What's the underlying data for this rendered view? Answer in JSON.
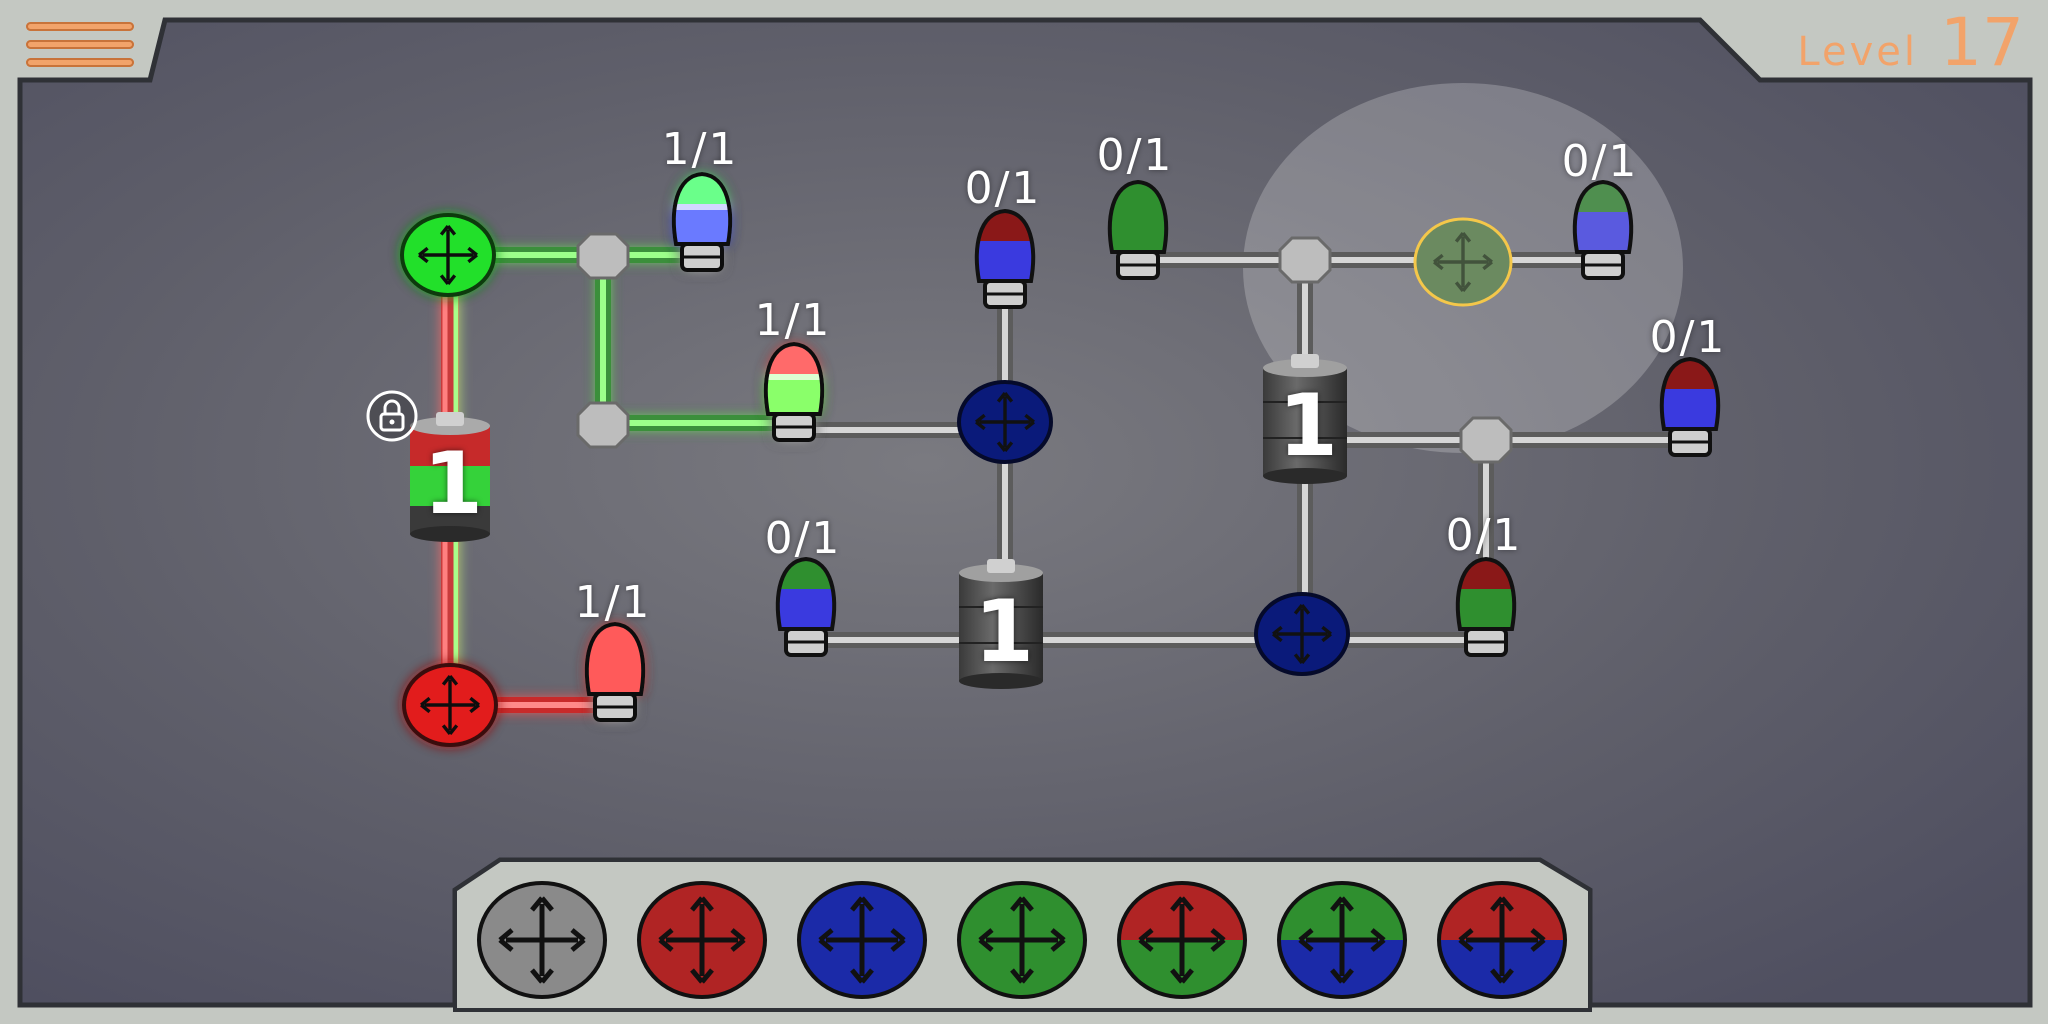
{
  "level": {
    "label": "Level",
    "number": "17"
  },
  "menu": {
    "icon": "hamburger-menu-icon"
  },
  "colors": {
    "accent": "#f2a36a",
    "red": "#b02424",
    "green": "#2f8f2f",
    "blue": "#1b2aa8",
    "gray": "#8a8a8a",
    "lit_red": "#ff4a4a",
    "lit_green": "#7cff6a"
  },
  "bulbs": [
    {
      "id": "bulb-green-blue-lit",
      "count": "1/1",
      "lit": true,
      "colors": [
        "green",
        "blue"
      ]
    },
    {
      "id": "bulb-red-green-lit",
      "count": "1/1",
      "lit": true,
      "colors": [
        "red",
        "green"
      ]
    },
    {
      "id": "bulb-red-lit",
      "count": "1/1",
      "lit": true,
      "colors": [
        "red"
      ]
    },
    {
      "id": "bulb-red-blue-1",
      "count": "0/1",
      "lit": false,
      "colors": [
        "red",
        "blue"
      ]
    },
    {
      "id": "bulb-green-1",
      "count": "0/1",
      "lit": false,
      "colors": [
        "green"
      ]
    },
    {
      "id": "bulb-green-blue-1",
      "count": "0/1",
      "lit": false,
      "colors": [
        "green",
        "blue"
      ]
    },
    {
      "id": "bulb-green-blue-2",
      "count": "0/1",
      "lit": false,
      "colors": [
        "green",
        "blue"
      ]
    },
    {
      "id": "bulb-red-blue-2",
      "count": "0/1",
      "lit": false,
      "colors": [
        "red",
        "blue"
      ]
    },
    {
      "id": "bulb-red-green-1",
      "count": "0/1",
      "lit": false,
      "colors": [
        "red",
        "green"
      ]
    }
  ],
  "batteries": [
    {
      "id": "battery-locked",
      "value": "1",
      "locked": true,
      "colors": [
        "red",
        "green"
      ]
    },
    {
      "id": "battery-center",
      "value": "1",
      "locked": false,
      "colors": []
    },
    {
      "id": "battery-right",
      "value": "1",
      "locked": false,
      "colors": []
    }
  ],
  "switches": [
    {
      "id": "switch-green",
      "color": "green"
    },
    {
      "id": "switch-red",
      "color": "red"
    },
    {
      "id": "switch-blue-1",
      "color": "blue"
    },
    {
      "id": "switch-blue-2",
      "color": "blue"
    },
    {
      "id": "switch-green-selected",
      "color": "green",
      "selected": true
    }
  ],
  "palette": [
    {
      "id": "palette-gray",
      "colors": [
        "gray"
      ]
    },
    {
      "id": "palette-red",
      "colors": [
        "red"
      ]
    },
    {
      "id": "palette-blue",
      "colors": [
        "blue"
      ]
    },
    {
      "id": "palette-green",
      "colors": [
        "green"
      ]
    },
    {
      "id": "palette-red-green",
      "colors": [
        "red",
        "green"
      ]
    },
    {
      "id": "palette-green-blue",
      "colors": [
        "green",
        "blue"
      ]
    },
    {
      "id": "palette-red-blue",
      "colors": [
        "red",
        "blue"
      ]
    }
  ]
}
